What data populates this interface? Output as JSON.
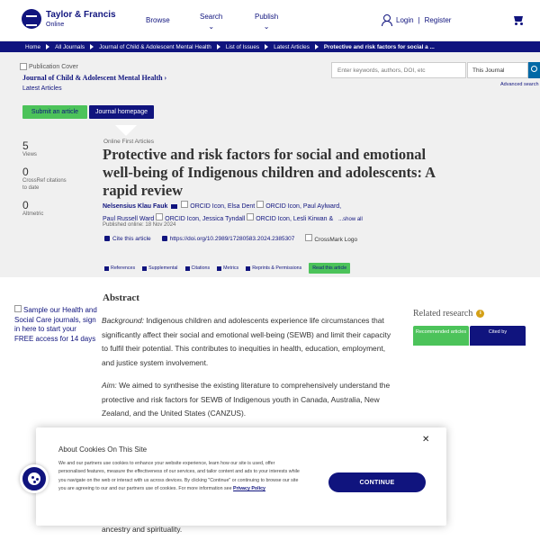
{
  "header": {
    "logo_name": "Taylor & Francis",
    "logo_sub": "Online",
    "nav": {
      "browse": "Browse",
      "search": "Search",
      "publish": "Publish"
    },
    "login": "Login",
    "separator": "|",
    "register": "Register"
  },
  "breadcrumb": [
    "Home",
    "All Journals",
    "Journal of Child & Adolescent Mental Health",
    "List of Issues",
    "Latest Articles",
    "Protective and risk factors for social a ..."
  ],
  "journal": {
    "cover_alt": "Publication Cover",
    "title": "Journal of Child & Adolescent Mental Health ›",
    "latest_articles": "Latest Articles",
    "submit_label": "Submit an article",
    "homepage_label": "Journal homepage"
  },
  "search": {
    "placeholder": "Enter keywords, authors, DOI, etc",
    "scope": "This Journal",
    "advanced": "Advanced search"
  },
  "metrics": [
    {
      "value": "5",
      "label": "Views"
    },
    {
      "value": "0",
      "label": "CrossRef citations to date"
    },
    {
      "value": "0",
      "label": "Altmetric"
    }
  ],
  "article": {
    "type": "Online First Articles",
    "title": "Protective and risk factors for social and emotional well-being of Indigenous children and adolescents: A rapid review",
    "authors": {
      "a1": "Nelsensius Klau Fauk",
      "orcid": "ORCID Icon",
      "a2": "Elsa Dent",
      "a3": "Paul Aylward,",
      "a4": "Paul Russell Ward",
      "a5": "Jessica Tyndall",
      "a6": "Lesli Kirwan &",
      "show_all": "...show all"
    },
    "published": "Published online: 18 Nov 2024",
    "cite": "Cite this article",
    "doi": "https://doi.org/10.2989/17280583.2024.2385307",
    "crossmark": "CrossMark Logo"
  },
  "tabs": {
    "references": "References",
    "supplemental": "Supplemental",
    "citations": "Citations",
    "metrics": "Metrics",
    "reprints": "Reprints & Permissions",
    "read": "Read this article"
  },
  "ad_text": "Sample our Health and Social Care journals, sign in here to start your FREE access for 14 days",
  "abstract": {
    "heading": "Abstract",
    "bg_lead": "Background:",
    "bg_text": "Indigenous children and adolescents experience life circumstances that significantly affect their social and emotional well-being (SEWB) and limit their capacity to fulfil their potential. This contributes to inequities in health, education, employment, and justice system involvement.",
    "aim_lead": "Aim:",
    "aim_text": "We aimed to synthesise the existing literature to comprehensively understand the protective and risk factors for SEWB of Indigenous youth in Canada, Australia, New Zealand, and the United States (CANZUS).",
    "tail": "ancestry and spirituality."
  },
  "related": {
    "heading": "Related research",
    "info": "i",
    "tab_recommended": "Recommended articles",
    "tab_cited": "Cited by"
  },
  "cookie": {
    "close": "✕",
    "title": "About Cookies On This Site",
    "body": "We and our partners use cookies to enhance your website experience, learn how our site is used, offer personalised features, measure the effectiveness of our services, and tailor content and ads to your interests while you navigate on the web or interact with us across devices. By clicking \"Continue\" or continuing to browse our site you are agreeing to our and our partners use of cookies. For more information see",
    "policy": "Privacy Policy",
    "continue": "CONTINUE"
  },
  "colors": {
    "brand": "#10147e",
    "accent": "#4cc35a",
    "gold": "#d4a017"
  }
}
